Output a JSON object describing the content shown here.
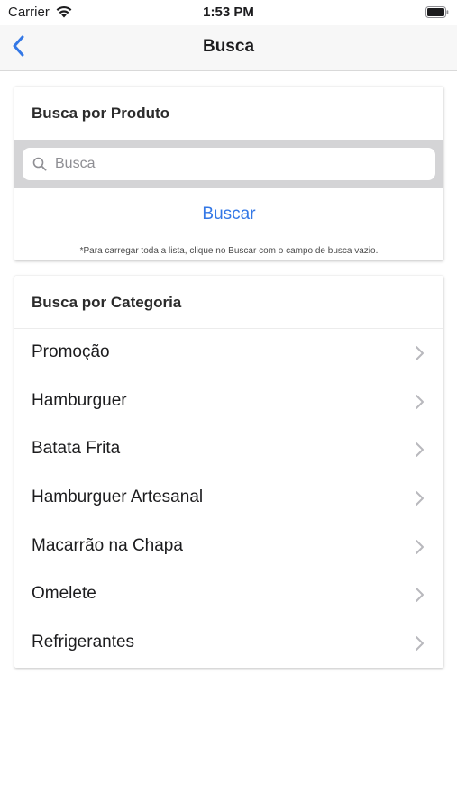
{
  "status_bar": {
    "carrier": "Carrier",
    "time": "1:53 PM",
    "wifi_icon": "wifi-icon",
    "battery_icon": "battery-icon"
  },
  "nav": {
    "title": "Busca",
    "back_icon": "chevron-left-icon",
    "accent_color": "#3478e6"
  },
  "product_search": {
    "heading": "Busca por Produto",
    "search_placeholder": "Busca",
    "search_value": "",
    "search_icon": "search-icon",
    "button_label": "Buscar",
    "hint": "*Para carregar toda a lista, clique no Buscar com o campo de busca vazio."
  },
  "category_search": {
    "heading": "Busca por Categoria",
    "items": [
      {
        "label": "Promoção"
      },
      {
        "label": "Hamburguer"
      },
      {
        "label": "Batata Frita"
      },
      {
        "label": "Hamburguer Artesanal"
      },
      {
        "label": "Macarrão na Chapa"
      },
      {
        "label": "Omelete"
      },
      {
        "label": "Refrigerantes"
      }
    ],
    "item_icon": "chevron-right-icon"
  }
}
